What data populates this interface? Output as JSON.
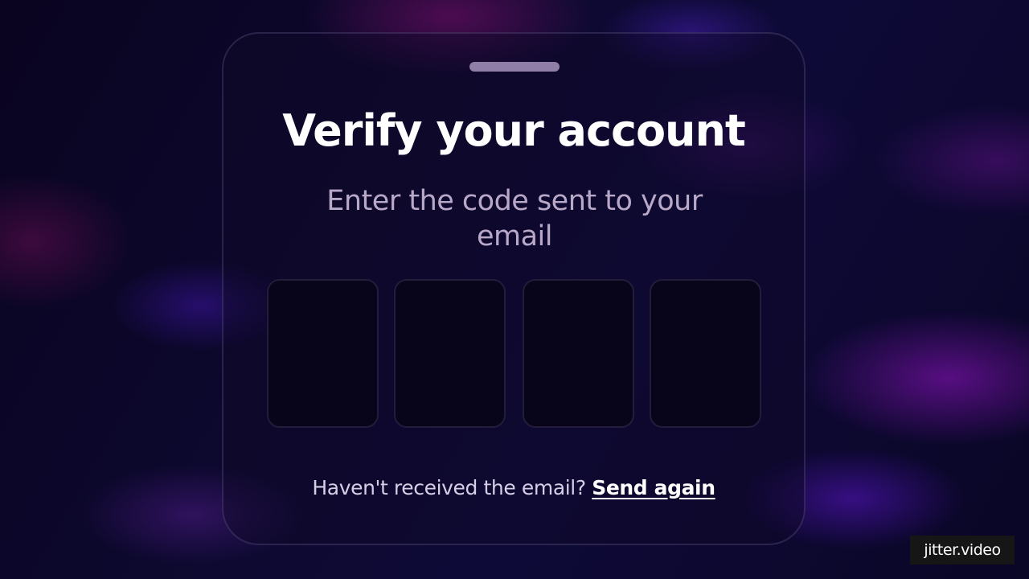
{
  "modal": {
    "title": "Verify your account",
    "subtitle": "Enter the code sent to your email",
    "code_digits": [
      "",
      "",
      "",
      ""
    ],
    "resend_prompt": "Haven't received the email?",
    "resend_link": "Send again"
  },
  "watermark": {
    "text": "jitter.video"
  },
  "colors": {
    "background": "#0c0828",
    "title": "#ffffff",
    "subtitle": "#b9a9c9",
    "code_box": "#08041a",
    "handle": "#8f7fa8"
  }
}
